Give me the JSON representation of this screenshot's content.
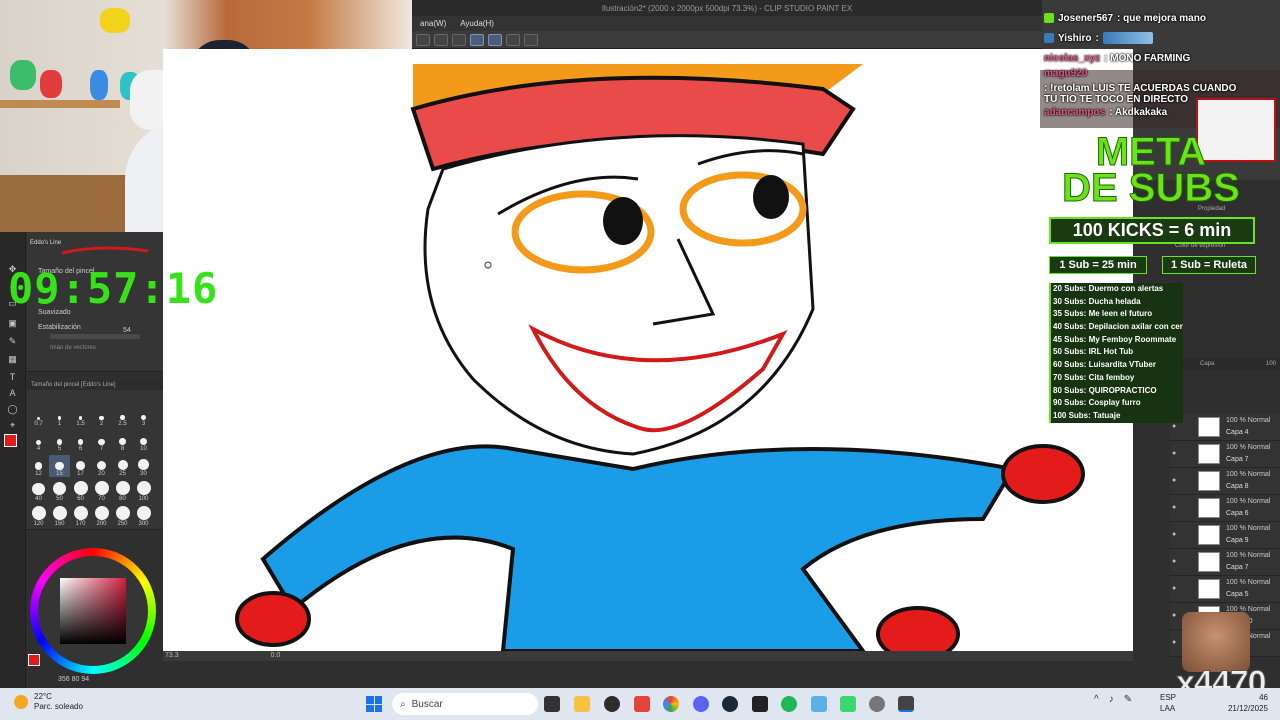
{
  "app": {
    "title": "Ilustración2* (2000 x 2000px 500dpi 73.3%) - CLIP STUDIO PAINT EX",
    "menu": [
      "ana(W)",
      "Ayuda(H)"
    ]
  },
  "timer": {
    "text": "09:57:16"
  },
  "tool_panel": {
    "brush_name": "Eddo's Line",
    "brush_size_label": "Tamaño del pincel",
    "smoothing_label": "Suavizado",
    "stabilization_label": "Estabilización",
    "stabilization_value": "54",
    "vector_label": "Imán de vectores",
    "size_panel_title": "Tamaño del pincel [Eddo's Line]",
    "sizes": [
      "0.7",
      "1",
      "1.5",
      "2",
      "2.5",
      "3",
      "4",
      "5",
      "6",
      "7",
      "8",
      "10",
      "12",
      "15",
      "17",
      "20",
      "25",
      "30",
      "40",
      "50",
      "60",
      "70",
      "80",
      "100",
      "120",
      "150",
      "170",
      "200",
      "250",
      "300"
    ],
    "selected_size": "15",
    "hsv_readout": "356  80  94"
  },
  "canvas": {
    "zoom": "73.3",
    "rotation": "0.0"
  },
  "chat": {
    "messages": [
      {
        "user": "Josener567",
        "text": ": que mejora mano",
        "user_color": "#ffffff"
      },
      {
        "user": "Yishiro",
        "text": ":",
        "user_color": "#ffffff"
      },
      {
        "user": "nicolas_xyz",
        "text": ": MONO FARMING",
        "user_color": "#e0558a"
      },
      {
        "user": "magu920",
        "text": ": !retolam LUIS TE ACUERDAS CUANDO TU TIO TE TOCO EN DIRECTO",
        "user_color": "#e0558a"
      },
      {
        "user": "adancampos",
        "text": ": Akdkakaka",
        "user_color": "#e0558a"
      }
    ]
  },
  "goals": {
    "title_line1": "META",
    "title_line2": "DE SUBS",
    "kicks": "100 KICKS = 6 min",
    "rate1": "1 Sub = 25 min",
    "rate2": "1 Sub = Ruleta",
    "list": [
      "20 Subs: Duermo con alertas",
      "30 Subs: Ducha helada",
      "35 Subs: Me leen el futuro",
      "40 Subs: Depilacion axilar con cera",
      "45 Subs: My Femboy Roommate",
      "50 Subs: IRL Hot Tub",
      "60 Subs: Luisardita VTuber",
      "70 Subs: Cita femboy",
      "80 Subs: QUIROPRACTICO",
      "90 Subs: Cosplay furro",
      "100 Subs: Tatuaje"
    ]
  },
  "right_panel": {
    "property_label": "Propiedad",
    "color_expr_label": "Color de expresión",
    "layer_panel_title": "Capa",
    "opacity": "100",
    "layers": [
      {
        "mode": "100 % Normal",
        "name": "Capa 4"
      },
      {
        "mode": "100 % Normal",
        "name": "Capa 7"
      },
      {
        "mode": "100 % Normal",
        "name": "Capa 8"
      },
      {
        "mode": "100 % Normal",
        "name": "Capa 6"
      },
      {
        "mode": "100 % Normal",
        "name": "Capa 9"
      },
      {
        "mode": "100 % Normal",
        "name": "Capa 7"
      },
      {
        "mode": "100 % Normal",
        "name": "Capa 5"
      },
      {
        "mode": "100 % Normal",
        "name": "Capa 10"
      },
      {
        "mode": "100 % Normal",
        "name": ""
      }
    ]
  },
  "overlay": {
    "watermark": "x4470"
  },
  "taskbar": {
    "weather_temp": "22°C",
    "weather_desc": "Parc. soleado",
    "search_placeholder": "Buscar",
    "lang1": "ESP",
    "lang2": "LAA",
    "time": "",
    "time_partial": "46",
    "date": "21/12/2025"
  },
  "colors": {
    "accent_green": "#6be21a",
    "brush_red": "#e41b1b",
    "clown_blue": "#1a9de6",
    "clown_orange": "#f39a1a"
  }
}
